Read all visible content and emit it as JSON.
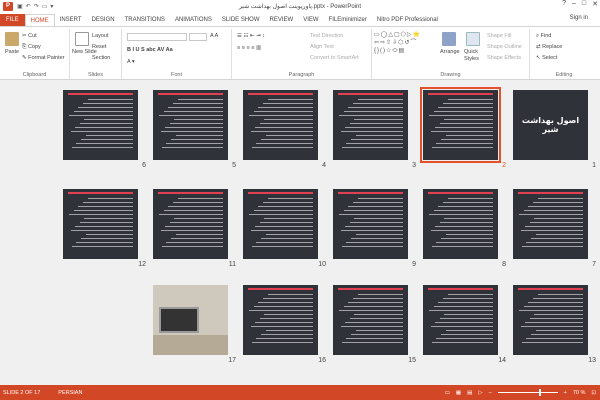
{
  "window": {
    "title": "پاورپوینت اصول بهداشت شیر.pptx - PowerPoint",
    "sign_in": "Sign in",
    "controls": [
      "?",
      "–",
      "□",
      "✕"
    ]
  },
  "tabs": [
    {
      "label": "FILE"
    },
    {
      "label": "HOME"
    },
    {
      "label": "INSERT"
    },
    {
      "label": "DESIGN"
    },
    {
      "label": "TRANSITIONS"
    },
    {
      "label": "ANIMATIONS"
    },
    {
      "label": "SLIDE SHOW"
    },
    {
      "label": "REVIEW"
    },
    {
      "label": "VIEW"
    },
    {
      "label": "FILEminimizer"
    },
    {
      "label": "Nitro PDF Professional"
    }
  ],
  "active_tab": "HOME",
  "ribbon": {
    "clipboard": {
      "label": "Clipboard",
      "paste": "Paste",
      "cut": "Cut",
      "copy": "Copy",
      "format_painter": "Format Painter"
    },
    "slides": {
      "label": "Slides",
      "new_slide": "New Slide",
      "layout": "Layout",
      "reset": "Reset",
      "section": "Section"
    },
    "font": {
      "label": "Font"
    },
    "paragraph": {
      "label": "Paragraph",
      "text_direction": "Text Direction",
      "align_text": "Align Text",
      "convert": "Convert to SmartArt"
    },
    "drawing": {
      "label": "Drawing",
      "arrange": "Arrange",
      "quick_styles": "Quick Styles",
      "shape_fill": "Shape Fill",
      "shape_outline": "Shape Outline",
      "shape_effects": "Shape Effects"
    },
    "editing": {
      "label": "Editing",
      "find": "Find",
      "replace": "Replace",
      "select": "Select"
    }
  },
  "slides": [
    {
      "num": "1",
      "title": "اصول بهداشت شیر",
      "kind": "title"
    },
    {
      "num": "2",
      "kind": "text",
      "selected": true
    },
    {
      "num": "3",
      "kind": "text"
    },
    {
      "num": "4",
      "kind": "text"
    },
    {
      "num": "5",
      "kind": "text"
    },
    {
      "num": "6",
      "kind": "text"
    },
    {
      "num": "7",
      "kind": "text"
    },
    {
      "num": "8",
      "kind": "text"
    },
    {
      "num": "9",
      "kind": "text"
    },
    {
      "num": "10",
      "kind": "text"
    },
    {
      "num": "11",
      "kind": "text"
    },
    {
      "num": "12",
      "kind": "text"
    },
    {
      "num": "13",
      "kind": "text"
    },
    {
      "num": "14",
      "kind": "text"
    },
    {
      "num": "15",
      "kind": "text"
    },
    {
      "num": "16",
      "kind": "text"
    },
    {
      "num": "17",
      "kind": "photo"
    }
  ],
  "status": {
    "slide_indicator": "SLIDE 2 OF 17",
    "language": "PERSIAN",
    "zoom": "70 %",
    "zoom_level": 0.7
  },
  "colors": {
    "accent": "#d24726",
    "selection": "#e2512a",
    "slide_bg": "#2f3238"
  }
}
